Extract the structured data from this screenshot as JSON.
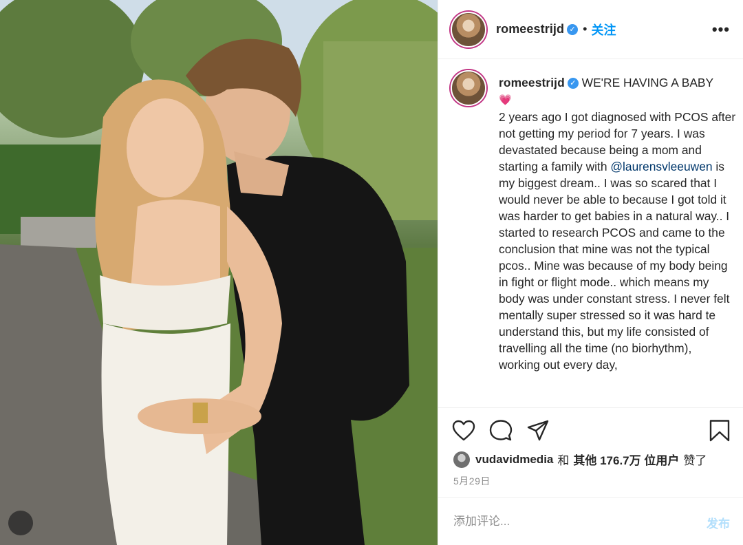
{
  "post": {
    "username": "romeestrijd",
    "verified_icon": "verified-badge-icon",
    "follow_label": "关注",
    "separator": "•",
    "more_label": "•••"
  },
  "caption": {
    "username": "romeestrijd",
    "headline": "WE'RE HAVING A BABY",
    "emoji": "💗",
    "body_part1": "2 years ago I got diagnosed with PCOS after not getting my period for 7 years. I was devastated because being a mom and starting a family with ",
    "mention": "@laurensvleeuwen",
    "body_part2": " is my biggest dream.. I was so scared that I would never be able to because I got told it was harder to get babies in a natural way.. I started to research PCOS and came to the conclusion that mine was not the typical pcos.. Mine was because of my body being in fight or flight mode.. which means my body was under constant stress. I never felt mentally super stressed so it was hard te understand this, but my life consisted of travelling all the time (no biorhythm), working out every day,"
  },
  "actions": {
    "like_icon": "heart-icon",
    "comment_icon": "comment-icon",
    "share_icon": "share-icon",
    "save_icon": "bookmark-icon"
  },
  "likes": {
    "liker": "vudavidmedia",
    "conj": "和",
    "others_label": "其他 176.7万 位用户",
    "suffix": "赞了"
  },
  "date": "5月29日",
  "comment": {
    "placeholder": "添加评论...",
    "post_label": "发布"
  },
  "colors": {
    "accent": "#0095f6",
    "verified": "#3897f0",
    "mention": "#00376b",
    "muted": "#8e8e8e",
    "post_disabled": "#b2dffc"
  }
}
